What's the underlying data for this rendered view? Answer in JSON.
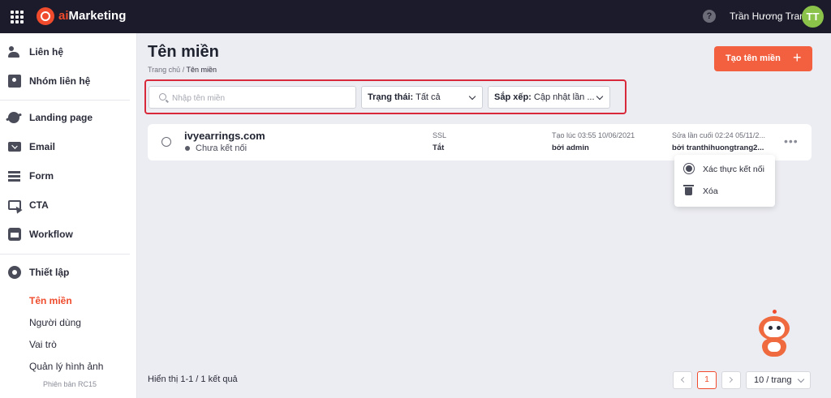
{
  "app": {
    "brand_prefix": "ai",
    "brand_suffix": "Marketing",
    "help_symbol": "?",
    "user_name": "Trần Hương Trang",
    "user_initials": "TT",
    "accent_color": "#ef4b2c",
    "icons": {
      "apps": "grid-icon",
      "help": "help-icon"
    }
  },
  "sidebar": {
    "items": [
      {
        "label": "Liên hệ",
        "icon": "contacts-icon"
      },
      {
        "label": "Nhóm liên hệ",
        "icon": "contact-book-icon"
      },
      {
        "label": "Landing page",
        "icon": "planet-icon"
      },
      {
        "label": "Email",
        "icon": "mail-icon"
      },
      {
        "label": "Form",
        "icon": "form-icon"
      },
      {
        "label": "CTA",
        "icon": "cta-icon"
      },
      {
        "label": "Workflow",
        "icon": "workflow-icon"
      },
      {
        "label": "Thiết lập",
        "icon": "gear-icon"
      }
    ],
    "sub_items": [
      {
        "label": "Tên miền",
        "active": true
      },
      {
        "label": "Người dùng",
        "active": false
      },
      {
        "label": "Vai trò",
        "active": false
      },
      {
        "label": "Quản lý hình ảnh",
        "active": false
      }
    ],
    "version": "Phiên bản RC15"
  },
  "page": {
    "title": "Tên miền",
    "breadcrumb_home": "Trang chủ",
    "breadcrumb_sep": " / ",
    "breadcrumb_current": "Tên miền",
    "create_button": "Tạo tên miền",
    "create_plus": "+"
  },
  "filters": {
    "search_placeholder": "Nhập tên miền",
    "search_value": "",
    "status_label": "Trạng thái:",
    "status_value": "Tất cả",
    "sort_label": "Sắp xếp:",
    "sort_value": "Cập nhật lần ..."
  },
  "rows": [
    {
      "domain": "ivyearrings.com",
      "status": "Chưa kết nối",
      "ssl_label": "SSL",
      "ssl_value": "Tắt",
      "created": "Tạo lúc 03:55 10/06/2021",
      "created_by": "bởi admin",
      "updated": "Sửa lần cuối 02:24 05/11/2...",
      "updated_by": "bởi tranthihuongtrang2...",
      "more": "•••"
    }
  ],
  "row_menu": {
    "items": [
      {
        "label": "Xác thực kết nối",
        "icon": "verify-icon"
      },
      {
        "label": "Xóa",
        "icon": "trash-icon"
      }
    ]
  },
  "footer": {
    "summary": "Hiển thị 1-1 / 1 kết quả",
    "current_page": "1",
    "page_size": "10 / trang"
  }
}
